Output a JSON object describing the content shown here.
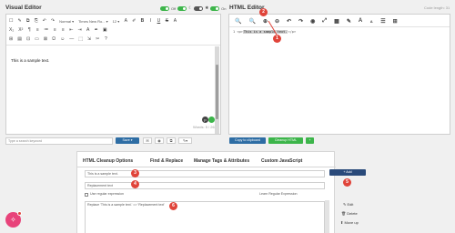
{
  "visual_editor": {
    "title": "Visual Editor",
    "toggle_labels": [
      "Off",
      "",
      "On"
    ],
    "toolbar_row1": [
      "☐",
      "✎",
      "⧉",
      "⎘",
      "↶",
      "↷",
      "Normal ▾",
      "Times New Ro... ▾",
      "12 ▾",
      "A",
      "✐",
      "B",
      "I",
      "U",
      "S",
      "A"
    ],
    "toolbar_row2": [
      "X₂",
      "X²",
      "¶",
      "≡",
      "≔",
      "≡",
      "≡",
      "⇤",
      "⇥",
      "A",
      "✒",
      "▣"
    ],
    "toolbar_row3": [
      "⊞",
      "▤",
      "⊡",
      "▭",
      "⊠",
      "Ω",
      "☺",
      "—",
      "⬚",
      "⇲",
      "✂",
      "?"
    ],
    "content": "This is a sample text.",
    "word_count": "Words: 5 / 26",
    "status_letter": "p"
  },
  "html_editor": {
    "title": "HTML Editor",
    "mode_text": "Code length: 31",
    "toolbar": [
      "🔍",
      "🔍",
      "⊕",
      "⊖",
      "↶",
      "↷",
      "◉",
      "⤢",
      "▦",
      "✎",
      "A",
      "A",
      "☰",
      "⊞"
    ],
    "line_number": "1",
    "code_prefix": "<p>",
    "code_highlight": "This is a sample text.",
    "code_suffix": "</p>"
  },
  "search": {
    "placeholder": "Type a search keyword",
    "save_label": "Save ▾",
    "copy_label": "Copy to clipboard",
    "cleanup_label": "Cleanup HTML",
    "plus_label": "+"
  },
  "panel": {
    "tabs": [
      "HTML Cleanup Options",
      "Find & Replace",
      "Manage Tags & Attributes",
      "Custom JavaScript"
    ],
    "find_value": "This is a sample text.",
    "replace_value": "Replacement text",
    "regex_label": "Use regular expression",
    "learn_label": "Learn Regular Expression",
    "add_label": "+ Add",
    "rule_text": "Replace 'This is a sample text.' => 'Replacement text'",
    "edit_label": "✎ Edit",
    "delete_label": "🗑 Delete",
    "moveup_label": "⬆ Move up"
  },
  "badges": [
    "1",
    "2",
    "3",
    "4",
    "5",
    "6"
  ],
  "colors": {
    "badge": "#e0443a",
    "blue_button": "#2e6da4",
    "green_button": "#3cb54a",
    "fab": "#e8437a"
  }
}
